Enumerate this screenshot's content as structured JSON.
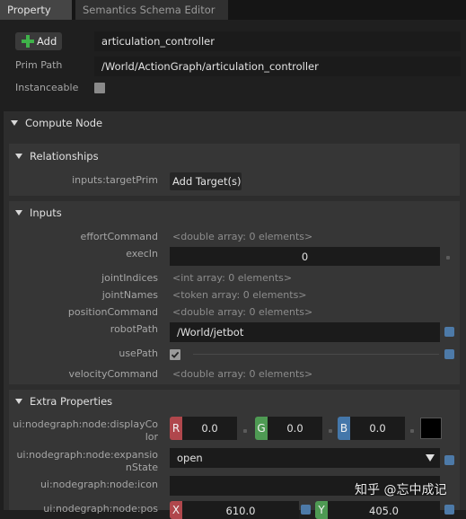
{
  "tabs": [
    {
      "label": "Property",
      "active": true
    },
    {
      "label": "Semantics Schema Editor",
      "active": false
    }
  ],
  "top": {
    "add_label": "Add",
    "name_value": "articulation_controller",
    "prim_path_label": "Prim Path",
    "prim_path_value": "/World/ActionGraph/articulation_controller",
    "instanceable_label": "Instanceable",
    "instanceable_checked": false
  },
  "compute_node": {
    "title": "Compute Node",
    "relationships": {
      "title": "Relationships",
      "target_label": "inputs:targetPrim",
      "add_target_label": "Add Target(s)"
    },
    "inputs": {
      "title": "Inputs",
      "effort_label": "effortCommand",
      "effort_value": "<double array: 0 elements>",
      "execin_label": "execIn",
      "execin_value": "0",
      "joint_indices_label": "jointIndices",
      "joint_indices_value": "<int array: 0 elements>",
      "joint_names_label": "jointNames",
      "joint_names_value": "<token array: 0 elements>",
      "position_label": "positionCommand",
      "position_value": "<double array: 0 elements>",
      "robot_path_label": "robotPath",
      "robot_path_value": "/World/jetbot",
      "use_path_label": "usePath",
      "use_path_checked": true,
      "velocity_label": "velocityCommand",
      "velocity_value": "<double array: 0 elements>"
    },
    "extra": {
      "title": "Extra Properties",
      "display_color_label_1": "ui:nodegraph:node:displayCo",
      "display_color_label_2": "lor",
      "r_chip": "R",
      "r_value": "0.0",
      "g_chip": "G",
      "g_value": "0.0",
      "b_chip": "B",
      "b_value": "0.0",
      "swatch_color": "#000000",
      "expansion_label_1": "ui:nodegraph:node:expansio",
      "expansion_label_2": "nState",
      "expansion_value": "open",
      "icon_label": "ui:nodegraph:node:icon",
      "pos_label": "ui:nodegraph:node:pos",
      "x_chip": "X",
      "x_value": "610.0",
      "y_chip": "Y",
      "y_value": "405.0"
    }
  },
  "watermark": "知乎 @忘中成记",
  "colors": {
    "chip_r": "#b0474c",
    "chip_g": "#4e9a53",
    "chip_b": "#4477aa",
    "accent_square": "#4d7aa8"
  }
}
